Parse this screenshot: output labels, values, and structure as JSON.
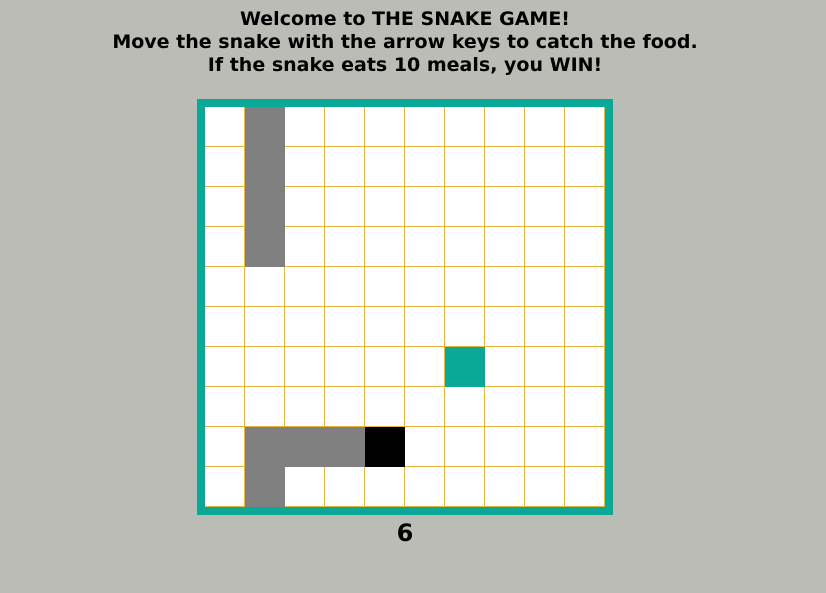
{
  "header": {
    "line1": "Welcome to THE SNAKE GAME!",
    "line2": "Move the snake with the arrow keys to catch the food.",
    "line3": "If the snake eats 10 meals, you WIN!"
  },
  "board": {
    "cols": 10,
    "rows": 10,
    "snake_body": [
      [
        1,
        0
      ],
      [
        1,
        1
      ],
      [
        1,
        2
      ],
      [
        1,
        3
      ],
      [
        1,
        8
      ],
      [
        2,
        8
      ],
      [
        3,
        8
      ],
      [
        1,
        9
      ]
    ],
    "snake_head": [
      4,
      8
    ],
    "food": [
      6,
      6
    ]
  },
  "score": "6",
  "colors": {
    "background": "#bcbcb6",
    "frame": "#0aa896",
    "grid_line": "#e8b43a",
    "snake_body": "#808080",
    "snake_head": "#000000",
    "food": "#0aa896"
  }
}
